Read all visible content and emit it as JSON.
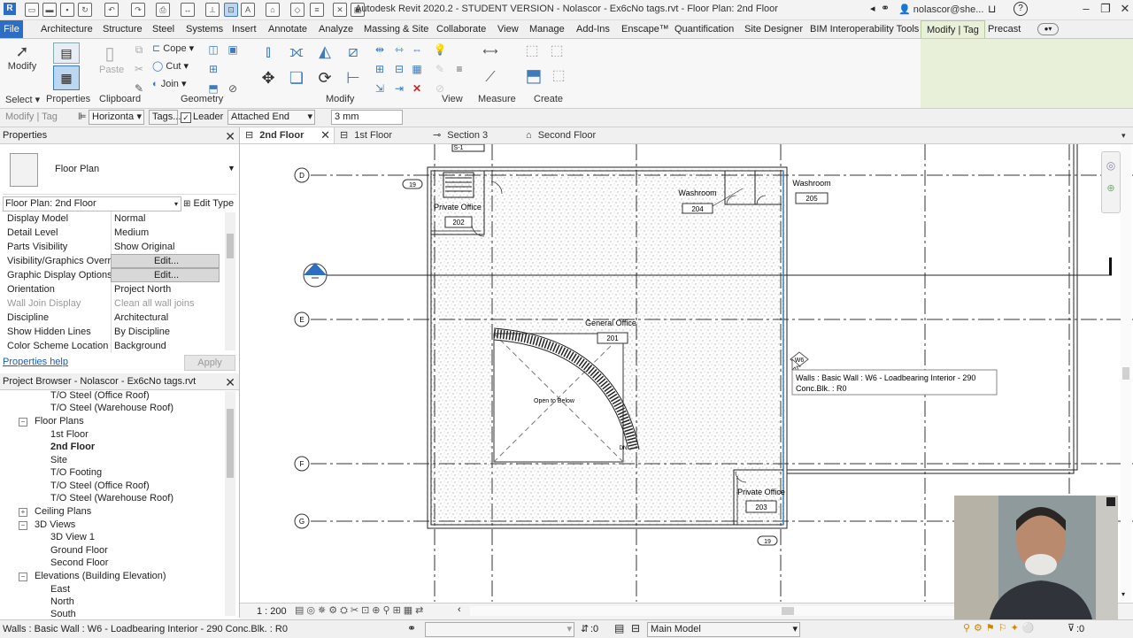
{
  "window": {
    "title": "Autodesk Revit 2020.2 - STUDENT VERSION - Nolascor - Ex6cNo tags.rvt - Floor Plan: 2nd Floor",
    "user": "nolascor@she..."
  },
  "tabs": [
    "File",
    "Architecture",
    "Structure",
    "Steel",
    "Systems",
    "Insert",
    "Annotate",
    "Analyze",
    "Massing & Site",
    "Collaborate",
    "View",
    "Manage",
    "Add-Ins",
    "Enscape™",
    "Quantification",
    "Site Designer",
    "BIM Interoperability Tools",
    "Modify | Tag",
    "Precast"
  ],
  "ribbon": {
    "modify_label": "Modify",
    "paste_label": "Paste",
    "cope_label": "Cope",
    "cut_label": "Cut",
    "join_label": "Join",
    "groups": [
      "Select",
      "Properties",
      "Clipboard",
      "Geometry",
      "Modify",
      "View",
      "Measure",
      "Create"
    ]
  },
  "options_bar": {
    "context": "Modify | Tag",
    "orientation": "Horizonta",
    "tags_button": "Tags...",
    "leader_label": "Leader",
    "leader_checked": true,
    "attach": "Attached End",
    "length": "3 mm"
  },
  "properties": {
    "header": "Properties",
    "type_name": "Floor Plan",
    "instance": "Floor Plan: 2nd Floor",
    "edit_type": "Edit Type",
    "rows": [
      {
        "k": "Display Model",
        "v": "Normal"
      },
      {
        "k": "Detail Level",
        "v": "Medium"
      },
      {
        "k": "Parts Visibility",
        "v": "Show Original"
      },
      {
        "k": "Visibility/Graphics Overr...",
        "v": "Edit..."
      },
      {
        "k": "Graphic Display Options",
        "v": "Edit..."
      },
      {
        "k": "Orientation",
        "v": "Project North"
      },
      {
        "k": "Wall Join Display",
        "v": "Clean all wall joins"
      },
      {
        "k": "Discipline",
        "v": "Architectural"
      },
      {
        "k": "Show Hidden Lines",
        "v": "By Discipline"
      },
      {
        "k": "Color Scheme Location",
        "v": "Background"
      }
    ],
    "help": "Properties help",
    "apply": "Apply"
  },
  "browser": {
    "header": "Project Browser - Nolascor - Ex6cNo tags.rvt",
    "items": [
      {
        "label": "T/O Steel (Office Roof)",
        "level": 2
      },
      {
        "label": "T/O Steel (Warehouse Roof)",
        "level": 2
      },
      {
        "label": "Floor Plans",
        "level": 1,
        "expander": "−"
      },
      {
        "label": "1st Floor",
        "level": 2
      },
      {
        "label": "2nd Floor",
        "level": 2,
        "bold": true
      },
      {
        "label": "Site",
        "level": 2
      },
      {
        "label": "T/O Footing",
        "level": 2
      },
      {
        "label": "T/O Steel (Office Roof)",
        "level": 2
      },
      {
        "label": "T/O Steel (Warehouse Roof)",
        "level": 2
      },
      {
        "label": "Ceiling Plans",
        "level": 1,
        "expander": "+"
      },
      {
        "label": "3D Views",
        "level": 1,
        "expander": "−"
      },
      {
        "label": "3D View 1",
        "level": 2
      },
      {
        "label": "Ground Floor",
        "level": 2
      },
      {
        "label": "Second Floor",
        "level": 2
      },
      {
        "label": "Elevations (Building Elevation)",
        "level": 1,
        "expander": "−"
      },
      {
        "label": "East",
        "level": 2
      },
      {
        "label": "North",
        "level": 2
      },
      {
        "label": "South",
        "level": 2
      }
    ]
  },
  "view_tabs": [
    "2nd Floor",
    "1st Floor",
    "Section 3",
    "Second Floor"
  ],
  "canvas": {
    "grids": [
      "D",
      "E",
      "F",
      "G"
    ],
    "rooms": [
      {
        "name": "Private Office",
        "number": "202"
      },
      {
        "name": "Washroom",
        "number": "204"
      },
      {
        "name": "Washroom",
        "number": "205"
      },
      {
        "name": "General Office",
        "number": "201"
      },
      {
        "name": "Private Office",
        "number": "203"
      }
    ],
    "open_to_below": "Open to Below",
    "stair_dn": "DN",
    "stair_top": "S-1",
    "level_tag_1": "19",
    "level_tag_2": "19",
    "wall_tag": "W6",
    "tooltip_line1": "Walls : Basic Wall : W6 - Loadbearing Interior - 290",
    "tooltip_line2": "Conc.Blk. : R0"
  },
  "view_control": {
    "scale": "1 : 200"
  },
  "status": {
    "text": "Walls : Basic Wall : W6 - Loadbearing Interior - 290 Conc.Blk. : R0",
    "worksets": ":0",
    "model": "Main Model",
    "filter": ":0"
  },
  "colors": {
    "file_tab": "#2e6dc4",
    "context_tab": "#e9f0da",
    "link": "#1a5fb4"
  }
}
